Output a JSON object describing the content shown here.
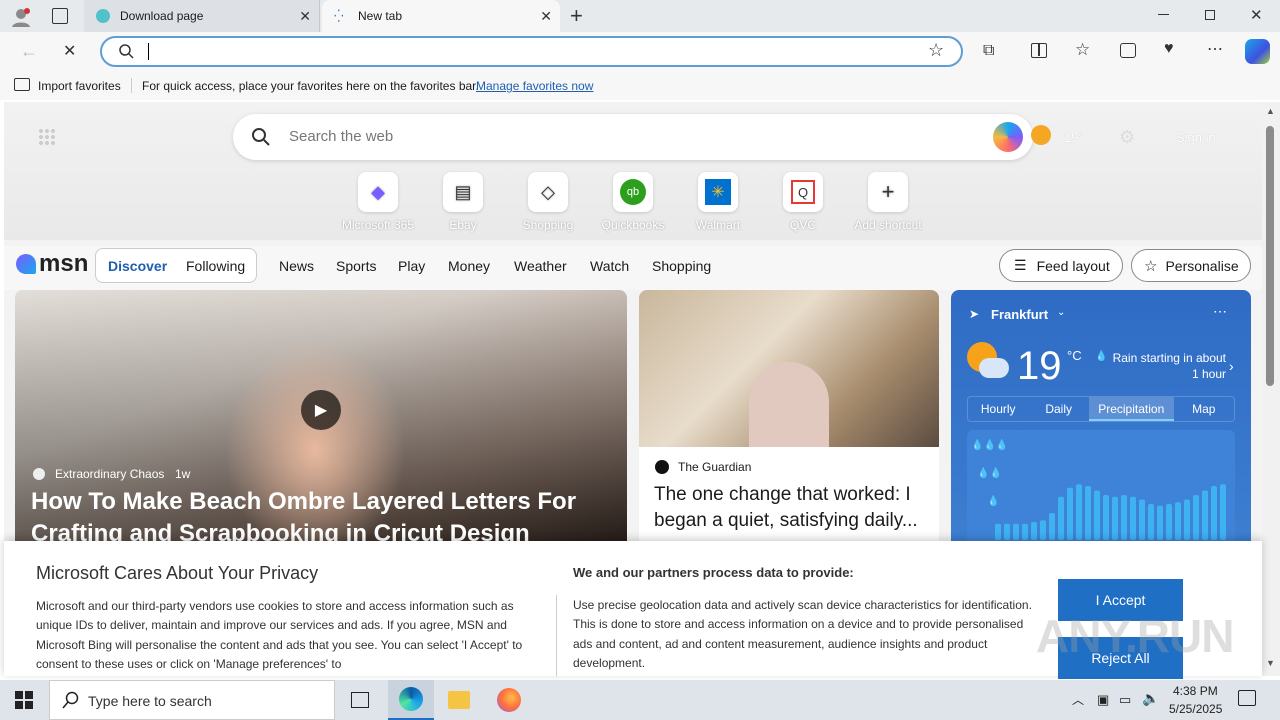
{
  "browser": {
    "tabs": [
      {
        "label": "Download page",
        "active": false
      },
      {
        "label": "New tab",
        "active": true
      }
    ],
    "address_placeholder": "",
    "favorites_bar": {
      "import_label": "Import favorites",
      "hint_text": "For quick access, place your favorites here on the favorites bar.",
      "manage_link": "Manage favorites now"
    },
    "window_controls": [
      "minimize",
      "restore",
      "close"
    ]
  },
  "newtab": {
    "search_placeholder": "Search the web",
    "weather_temp": "19°",
    "sign_in": "Sign in",
    "shortcuts": [
      {
        "label": "Microsoft 365"
      },
      {
        "label": "Ebay"
      },
      {
        "label": "Shopping"
      },
      {
        "label": "Quickbooks"
      },
      {
        "label": "Walmart"
      },
      {
        "label": "QVC"
      },
      {
        "label": "Add shortcut"
      }
    ]
  },
  "msn": {
    "logo": "msn",
    "toggle": [
      "Discover",
      "Following"
    ],
    "nav": [
      "News",
      "Sports",
      "Play",
      "Money",
      "Weather",
      "Watch",
      "Shopping"
    ],
    "feed_layout": "Feed layout",
    "personalise": "Personalise",
    "hero_card": {
      "source": "Extraordinary Chaos",
      "age": "1w",
      "title": "How To Make Beach Ombre Layered Letters For Crafting and Scrapbooking in Cricut Design Space"
    },
    "card2": {
      "source": "The Guardian",
      "title": "The one change that worked: I began a quiet, satisfying daily..."
    },
    "weather": {
      "city": "Frankfurt",
      "temp": "19",
      "unit": "°C",
      "note": "Rain starting in about 1 hour",
      "tabs": [
        "Hourly",
        "Daily",
        "Precipitation",
        "Map"
      ],
      "active_tab": "Precipitation",
      "bars": [
        0.18,
        0.18,
        0.18,
        0.18,
        0.2,
        0.22,
        0.3,
        0.48,
        0.58,
        0.62,
        0.6,
        0.55,
        0.5,
        0.48,
        0.5,
        0.48,
        0.45,
        0.4,
        0.38,
        0.4,
        0.42,
        0.45,
        0.5,
        0.55,
        0.6,
        0.62
      ]
    }
  },
  "privacy": {
    "title": "Microsoft Cares About Your Privacy",
    "body": "Microsoft and our third-party vendors use cookies to store and access information such as unique IDs to deliver, maintain and improve our services and ads. If you agree, MSN and Microsoft Bing will personalise the content and ads that you see. You can select 'I Accept' to consent to these uses or click on 'Manage preferences' to",
    "subtitle": "We and our partners process data to provide:",
    "body2": "Use precise geolocation data and actively scan device characteristics for identification. This is done to store and access information on a device and to provide personalised ads and content, ad and content measurement, audience insights and product development.",
    "accept": "I Accept",
    "reject": "Reject All"
  },
  "taskbar": {
    "search_placeholder": "Type here to search",
    "time": "4:38 PM",
    "date": "5/25/2025"
  },
  "watermark": "ANY.RUN",
  "colors": {
    "accent": "#1f6fc5",
    "tabbar": "#e7eaed"
  }
}
